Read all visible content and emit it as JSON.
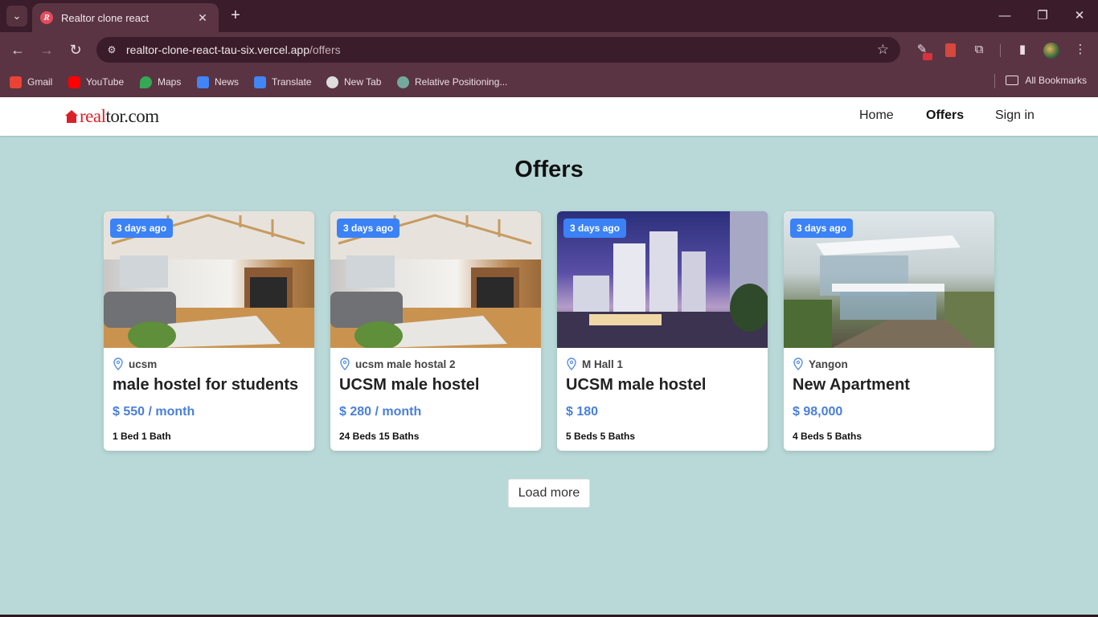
{
  "browser": {
    "tab_title": "Realtor clone react",
    "url_host": "realtor-clone-react-tau-six.vercel.app",
    "url_path": "/offers",
    "bookmarks": [
      {
        "label": "Gmail",
        "icon": "gmail-icon",
        "color": "#ea4335"
      },
      {
        "label": "YouTube",
        "icon": "youtube-icon",
        "color": "#ff0000"
      },
      {
        "label": "Maps",
        "icon": "maps-icon",
        "color": "#34a853"
      },
      {
        "label": "News",
        "icon": "news-icon",
        "color": "#4285f4"
      },
      {
        "label": "Translate",
        "icon": "translate-icon",
        "color": "#4285f4"
      },
      {
        "label": "New Tab",
        "icon": "globe-icon",
        "color": "#dddddd"
      },
      {
        "label": "Relative Positioning...",
        "icon": "chatgpt-icon",
        "color": "#74aa9c"
      }
    ],
    "all_bookmarks": "All Bookmarks"
  },
  "site": {
    "logo_real": "real",
    "logo_rest": "tor.com",
    "nav": {
      "home": "Home",
      "offers": "Offers",
      "sign_in": "Sign in"
    }
  },
  "page": {
    "title": "Offers",
    "load_more": "Load more"
  },
  "listings": [
    {
      "badge": "3 days ago",
      "location": "ucsm",
      "title": "male hostel for students",
      "price": "$ 550 / month",
      "rooms": "1 Bed 1 Bath"
    },
    {
      "badge": "3 days ago",
      "location": "ucsm male hostal 2",
      "title": "UCSM male hostel",
      "price": "$ 280 / month",
      "rooms": "24 Beds 15 Baths"
    },
    {
      "badge": "3 days ago",
      "location": "M Hall 1",
      "title": "UCSM male hostel",
      "price": "$ 180",
      "rooms": "5 Beds 5 Baths"
    },
    {
      "badge": "3 days ago",
      "location": "Yangon",
      "title": "New Apartment",
      "price": "$ 98,000",
      "rooms": "4 Beds 5 Baths"
    }
  ],
  "colors": {
    "accent": "#3b82f6",
    "price": "#4a7fd8",
    "brand_red": "#d92228",
    "page_bg": "#b9d8d8"
  }
}
